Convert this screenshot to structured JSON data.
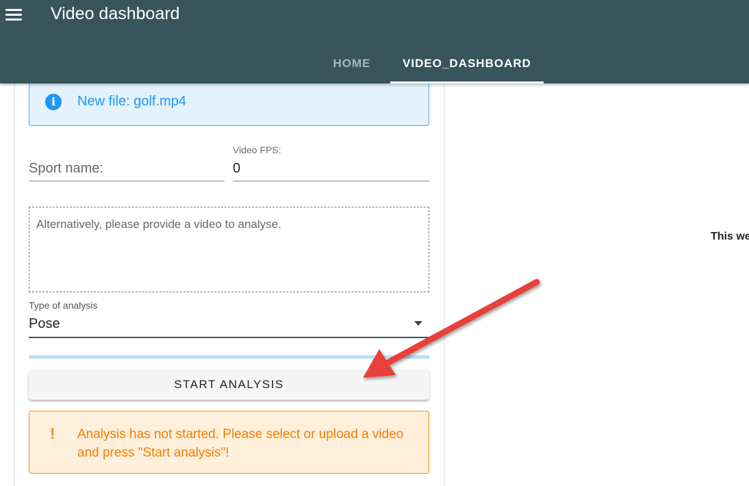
{
  "header": {
    "title": "Video dashboard",
    "menu_icon": "hamburger-menu-icon",
    "tabs": [
      {
        "label": "HOME",
        "active": false
      },
      {
        "label": "VIDEO_DASHBOARD",
        "active": true
      }
    ],
    "color": "#37555b"
  },
  "info_alert": {
    "icon": "info-icon",
    "text": "New file: golf.mp4",
    "color": "#2196f3"
  },
  "form": {
    "sport_name": {
      "placeholder": "Sport name:",
      "value": ""
    },
    "video_fps": {
      "label": "Video FPS:",
      "value": "0"
    },
    "dropzone_text": "Alternatively, please provide a video to analyse.",
    "analysis_type": {
      "label": "Type of analysis",
      "value": "Pose"
    },
    "start_button": "START ANALYSIS"
  },
  "warning_alert": {
    "icon": "!",
    "text": "Analysis has not started. Please select or upload a video and press \"Start analysis\"!",
    "color": "#f57c00"
  },
  "side_text": "This we",
  "annotation": {
    "type": "red-arrow",
    "color": "#e8413b"
  }
}
